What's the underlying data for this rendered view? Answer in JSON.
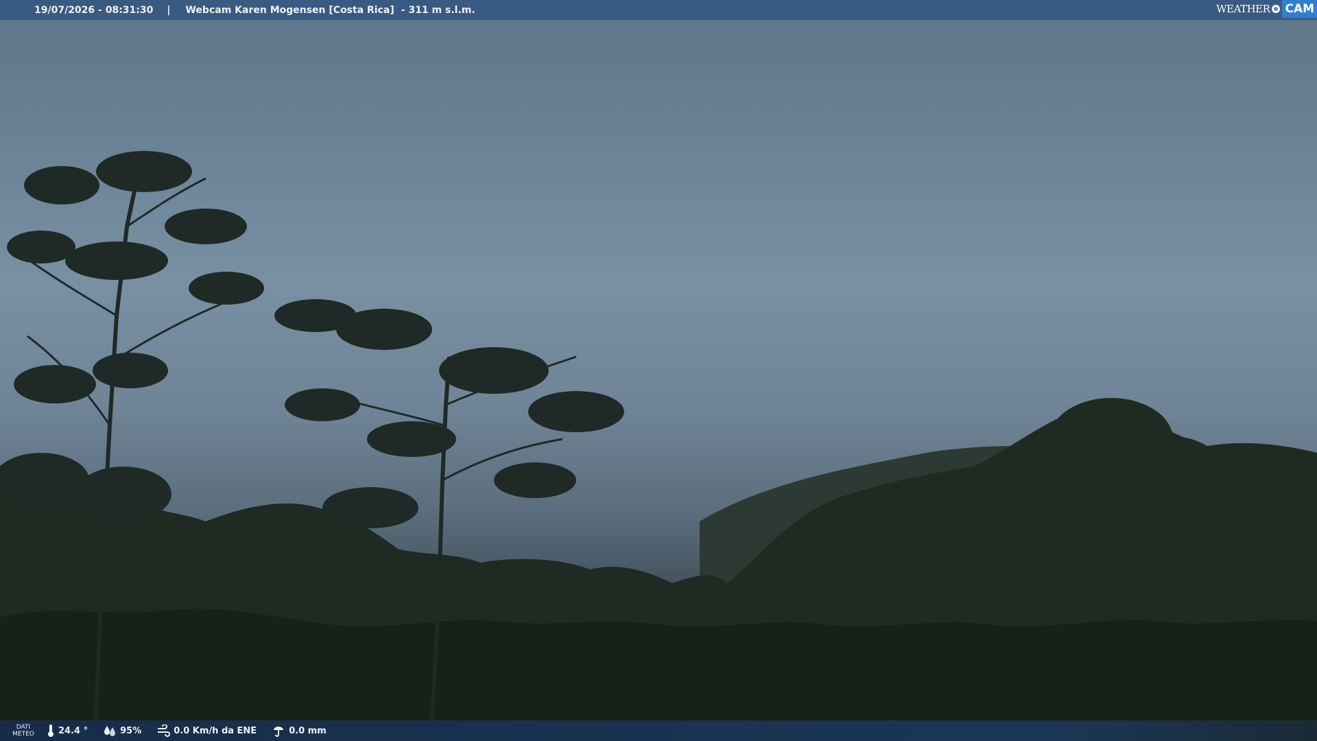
{
  "top_bar": {
    "timestamp": "19/07/2026 - 08:31:30",
    "separator": "|",
    "location": "Webcam Karen Mogensen [Costa Rica]",
    "altitude": "- 311 m s.l.m."
  },
  "logo": {
    "text_left": "WEATHER",
    "text_right": "CAM"
  },
  "bottom_bar": {
    "label_line1": "DATI",
    "label_line2": "METEO",
    "temperature": "24.4 °",
    "humidity": "95%",
    "wind": "0.0 Km/h da ENE",
    "rain": "0.0 mm"
  },
  "colors": {
    "top_bar": "#345680",
    "bottom_bar": "#162d4e",
    "logo_accent": "#2f7fd0",
    "sky": "#7890a2",
    "foliage": "#1f2a22"
  },
  "icons": [
    "thermometer-icon",
    "humidity-drops-icon",
    "wind-icon",
    "rain-gauge-icon"
  ]
}
